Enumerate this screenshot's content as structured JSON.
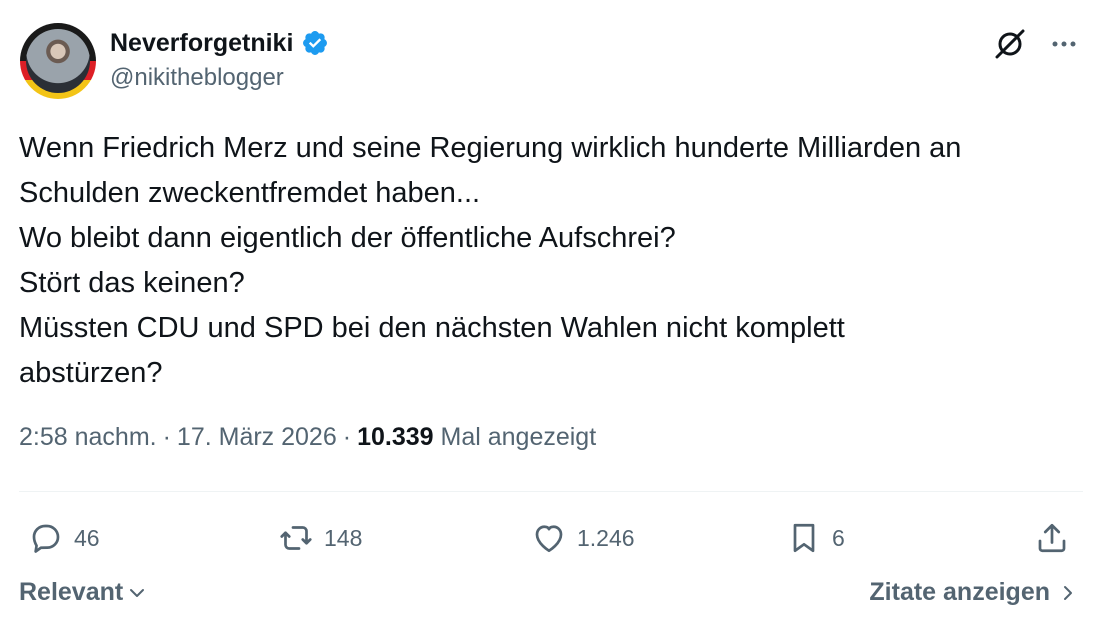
{
  "author": {
    "display_name": "Neverforgetniki",
    "handle": "@nikitheblogger",
    "verified": true,
    "verified_color": "#1d9bf0"
  },
  "header_icons": [
    "grok-icon",
    "more-icon"
  ],
  "tweet": {
    "lines": [
      "Wenn Friedrich Merz und seine Regierung wirklich hunderte Milliarden an",
      "Schulden zweckentfremdet haben...",
      "Wo bleibt dann eigentlich der öffentliche Aufschrei?",
      "Stört das keinen?",
      "Müssten CDU und SPD bei den nächsten Wahlen nicht komplett",
      "abstürzen?"
    ]
  },
  "meta": {
    "time": "2:58 nachm.",
    "separator": "·",
    "date": "17. März 2026",
    "views_count": "10.339",
    "views_label": "Mal angezeigt"
  },
  "actions": {
    "replies": "46",
    "retweets": "148",
    "likes": "1.246",
    "bookmarks": "6"
  },
  "footer": {
    "sort_label": "Relevant",
    "quotes_label": "Zitate anzeigen"
  },
  "colors": {
    "text_primary": "#0f1419",
    "text_secondary": "#536471",
    "divider": "#eff3f4",
    "flag_black": "#1a1a1a",
    "flag_red": "#dd1f26",
    "flag_gold": "#f3c416"
  }
}
